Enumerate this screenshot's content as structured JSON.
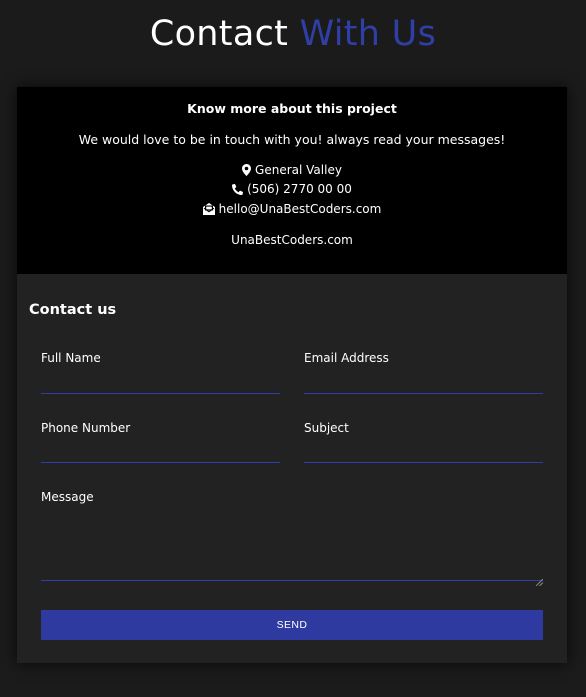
{
  "header": {
    "title_part1": "Contact",
    "title_part2": "With Us",
    "accent_color": "#2f3fa5"
  },
  "info": {
    "title": "Know more about this project",
    "description": "We would love to be in touch with you! always read your messages!",
    "location": "General Valley",
    "location_icon": "map-marker-icon",
    "phone": "(506) 2770 00 00",
    "phone_icon": "phone-icon",
    "email": "hello@UnaBestCoders.com",
    "email_icon": "envelope-open-icon",
    "website": "UnaBestCoders.com"
  },
  "form": {
    "title": "Contact us",
    "full_name_label": "Full Name",
    "full_name_value": "",
    "email_label": "Email Address",
    "email_value": "",
    "phone_label": "Phone Number",
    "phone_value": "",
    "subject_label": "Subject",
    "subject_value": "",
    "message_label": "Message",
    "message_value": "",
    "send_label": "SEND",
    "send_color": "#2f3aa1"
  }
}
